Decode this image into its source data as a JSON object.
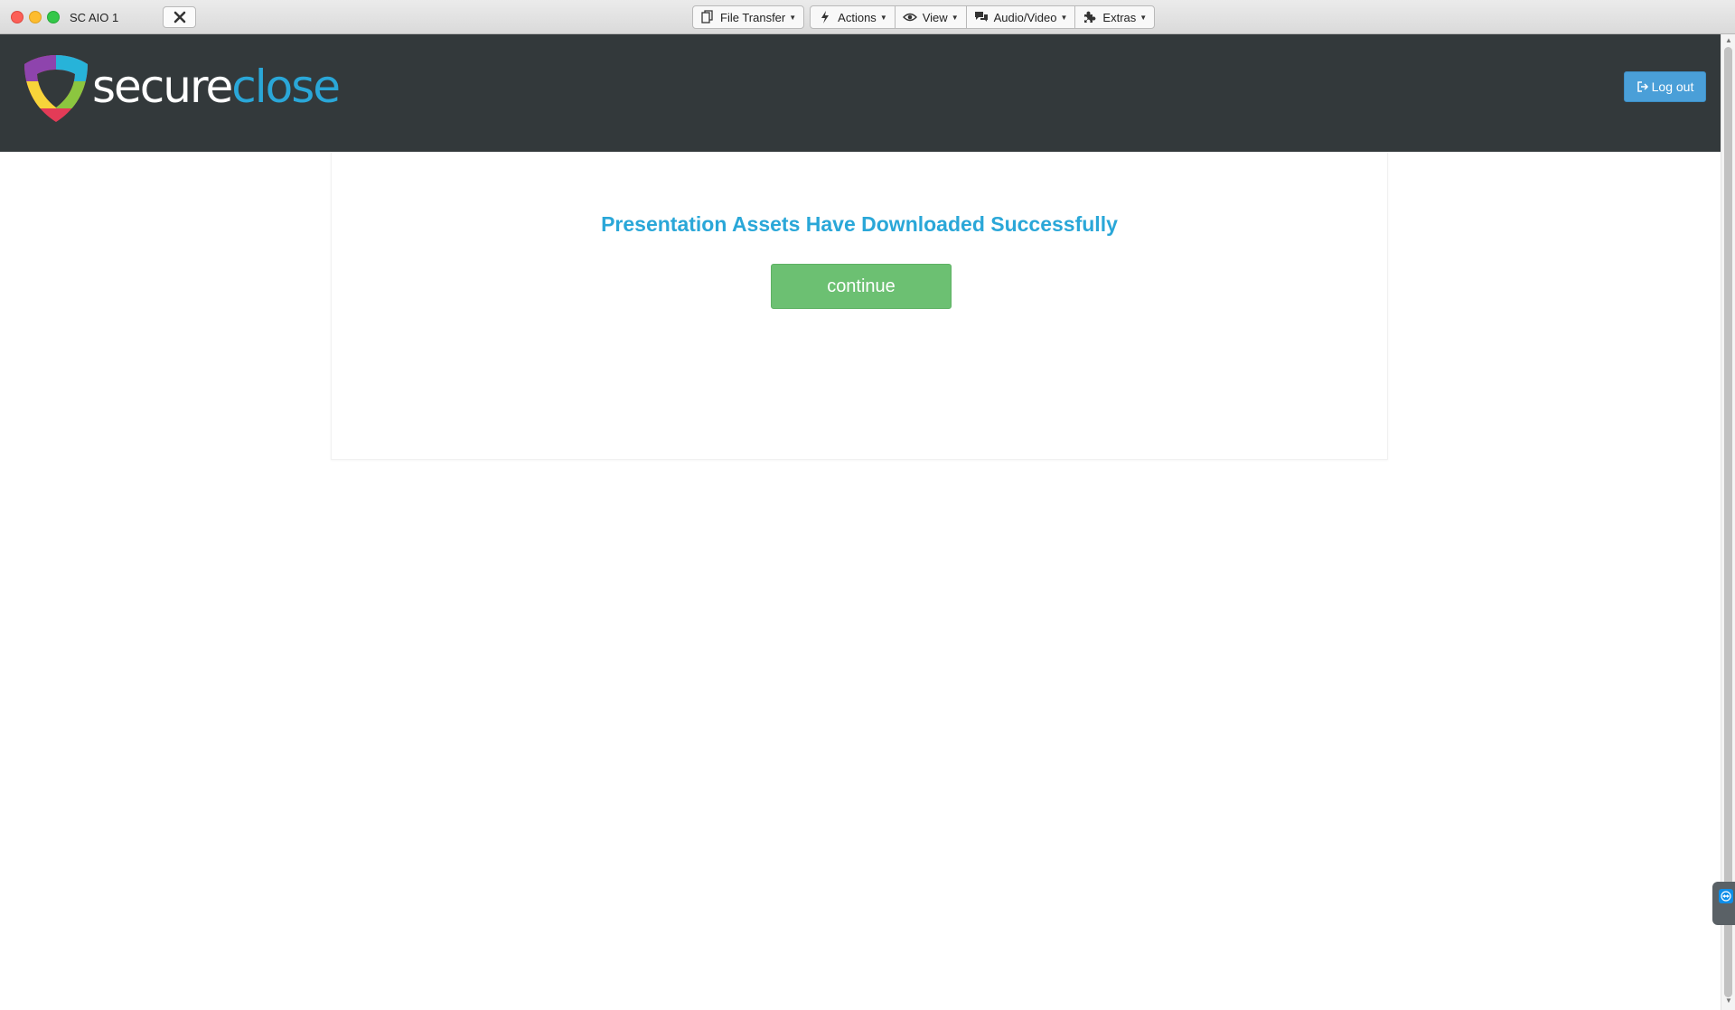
{
  "session": {
    "title": "SC AIO 1"
  },
  "toolbar": {
    "file_transfer": "File Transfer",
    "actions": "Actions",
    "view": "View",
    "audio_video": "Audio/Video",
    "extras": "Extras"
  },
  "header": {
    "logo_part1": "secure",
    "logo_part2": "close",
    "logout_label": "Log out"
  },
  "main": {
    "message": "Presentation Assets Have Downloaded Successfully",
    "continue_label": "continue"
  },
  "colors": {
    "header_bg": "#33393b",
    "brand_blue": "#2aa7d8",
    "continue_green": "#6cc072",
    "logout_blue": "#4a9fd8"
  }
}
